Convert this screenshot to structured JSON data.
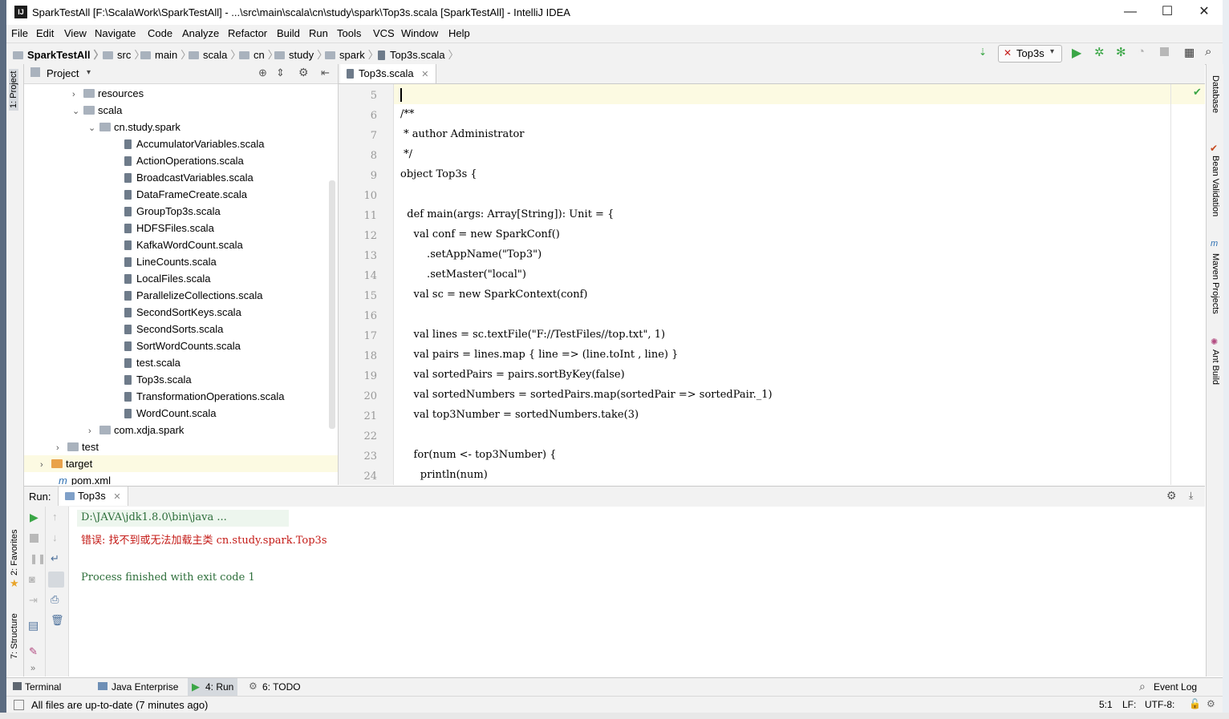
{
  "window": {
    "title": "SparkTestAll [F:\\ScalaWork\\SparkTestAll] - ...\\src\\main\\scala\\cn\\study\\spark\\Top3s.scala [SparkTestAll] - IntelliJ IDEA",
    "logo": "IJ",
    "minimize": "—",
    "maximize": "☐",
    "close": "✕"
  },
  "menu": [
    "File",
    "Edit",
    "View",
    "Navigate",
    "Code",
    "Analyze",
    "Refactor",
    "Build",
    "Run",
    "Tools",
    "VCS",
    "Window",
    "Help"
  ],
  "breadcrumb": [
    "SparkTestAll",
    "src",
    "main",
    "scala",
    "cn",
    "study",
    "spark",
    "Top3s.scala"
  ],
  "run_config": {
    "label": "Top3s"
  },
  "left_tools": {
    "project": "1: Project",
    "favorites": "2: Favorites",
    "structure": "7: Structure"
  },
  "right_tools": {
    "database": "Database",
    "bean": "Bean Validation",
    "maven": "Maven Projects",
    "ant": "Ant Build"
  },
  "project_panel": {
    "title": "Project",
    "tree": [
      {
        "label": "resources",
        "kind": "folder",
        "expanded": false
      },
      {
        "label": "scala",
        "kind": "folder",
        "expanded": true
      },
      {
        "label": "cn.study.spark",
        "kind": "folder",
        "expanded": true
      },
      {
        "label": "AccumulatorVariables.scala",
        "kind": "file"
      },
      {
        "label": "ActionOperations.scala",
        "kind": "file"
      },
      {
        "label": "BroadcastVariables.scala",
        "kind": "file"
      },
      {
        "label": "DataFrameCreate.scala",
        "kind": "file"
      },
      {
        "label": "GroupTop3s.scala",
        "kind": "file"
      },
      {
        "label": "HDFSFiles.scala",
        "kind": "file"
      },
      {
        "label": "KafkaWordCount.scala",
        "kind": "file"
      },
      {
        "label": "LineCounts.scala",
        "kind": "file"
      },
      {
        "label": "LocalFiles.scala",
        "kind": "file"
      },
      {
        "label": "ParallelizeCollections.scala",
        "kind": "file"
      },
      {
        "label": "SecondSortKeys.scala",
        "kind": "file"
      },
      {
        "label": "SecondSorts.scala",
        "kind": "file"
      },
      {
        "label": "SortWordCounts.scala",
        "kind": "file"
      },
      {
        "label": "test.scala",
        "kind": "file"
      },
      {
        "label": "Top3s.scala",
        "kind": "file"
      },
      {
        "label": "TransformationOperations.scala",
        "kind": "file"
      },
      {
        "label": "WordCount.scala",
        "kind": "file"
      },
      {
        "label": "com.xdja.spark",
        "kind": "folder",
        "expanded": false
      },
      {
        "label": "test",
        "kind": "folder",
        "expanded": false
      },
      {
        "label": "target",
        "kind": "orange-folder",
        "expanded": false
      },
      {
        "label": "pom.xml",
        "kind": "maven"
      }
    ]
  },
  "editor": {
    "tab": "Top3s.scala",
    "lines": [
      {
        "n": "5",
        "text": ""
      },
      {
        "n": "6",
        "text": "/**"
      },
      {
        "n": "7",
        "text": " * author Administrator"
      },
      {
        "n": "8",
        "text": " */"
      },
      {
        "n": "9",
        "text": "object Top3s {"
      },
      {
        "n": "10",
        "text": ""
      },
      {
        "n": "11",
        "text": "  def main(args: Array[String]): Unit = {"
      },
      {
        "n": "12",
        "text": "    val conf = new SparkConf()"
      },
      {
        "n": "13",
        "text": "        .setAppName(\"Top3\")"
      },
      {
        "n": "14",
        "text": "        .setMaster(\"local\")"
      },
      {
        "n": "15",
        "text": "    val sc = new SparkContext(conf)"
      },
      {
        "n": "16",
        "text": ""
      },
      {
        "n": "17",
        "text": "    val lines = sc.textFile(\"F://TestFiles//top.txt\", 1)"
      },
      {
        "n": "18",
        "text": "    val pairs = lines.map { line => (line.toInt , line) }"
      },
      {
        "n": "19",
        "text": "    val sortedPairs = pairs.sortByKey(false)"
      },
      {
        "n": "20",
        "text": "    val sortedNumbers = sortedPairs.map(sortedPair => sortedPair._1)"
      },
      {
        "n": "21",
        "text": "    val top3Number = sortedNumbers.take(3)"
      },
      {
        "n": "22",
        "text": ""
      },
      {
        "n": "23",
        "text": "    for(num <- top3Number) {"
      },
      {
        "n": "24",
        "text": "      println(num)"
      }
    ]
  },
  "run_panel": {
    "label": "Run:",
    "tab": "Top3s",
    "console": [
      {
        "text": "D:\\JAVA\\jdk1.8.0\\bin\\java ...",
        "color": "#2d6e3a"
      },
      {
        "text": "错误: 找不到或无法加载主类 cn.study.spark.Top3s",
        "color": "#c41a16"
      },
      {
        "text": "",
        "color": "#000000"
      },
      {
        "text": "Process finished with exit code 1",
        "color": "#2d6e3a"
      }
    ]
  },
  "bottom_tabs": [
    "Terminal",
    "Java Enterprise",
    "4: Run",
    "6: TODO"
  ],
  "event_log": "Event Log",
  "status": {
    "message": "All files are up-to-date (7 minutes ago)",
    "position": "5:1",
    "line_sep": "LF:",
    "encoding": "UTF-8:"
  },
  "colors": {
    "accent_green": "#3aa646",
    "error_red": "#c41a16",
    "output_green": "#2d6e3a",
    "caret_line": "#fcfae2"
  }
}
